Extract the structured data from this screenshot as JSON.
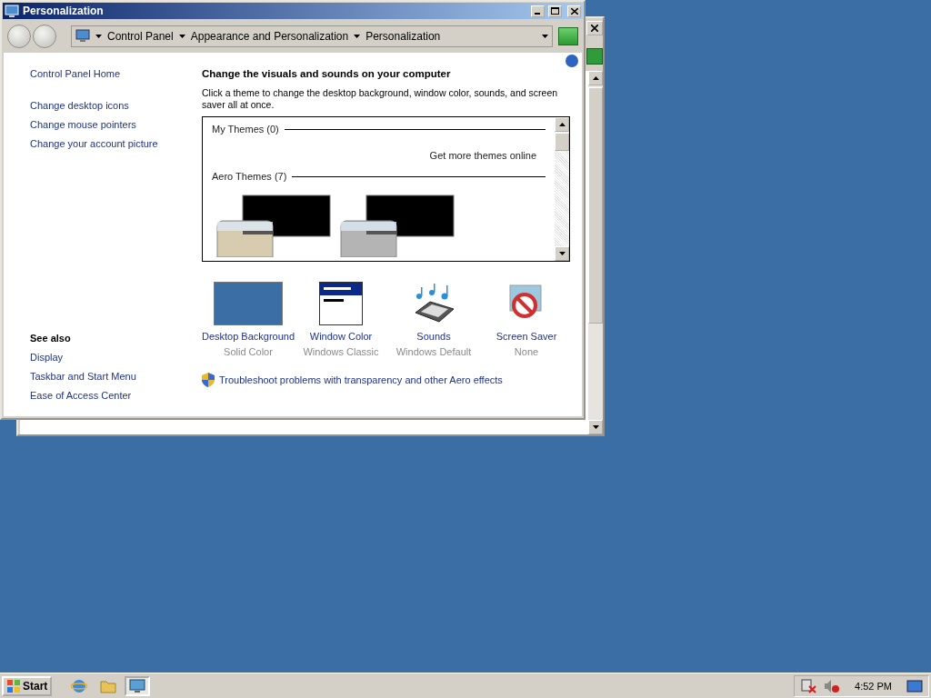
{
  "window": {
    "title": "Personalization",
    "breadcrumb": [
      "Control Panel",
      "Appearance and Personalization",
      "Personalization"
    ]
  },
  "sidebar": {
    "links": [
      "Control Panel Home",
      "Change desktop icons",
      "Change mouse pointers",
      "Change your account picture"
    ],
    "see_also_title": "See also",
    "see_also": [
      "Display",
      "Taskbar and Start Menu",
      "Ease of Access Center"
    ]
  },
  "main": {
    "heading": "Change the visuals and sounds on your computer",
    "description": "Click a theme to change the desktop background, window color, sounds, and screen saver all at once.",
    "theme_groups": [
      {
        "title": "My Themes (0)",
        "link": "Get more themes online"
      },
      {
        "title": "Aero Themes (7)",
        "themes": [
          {
            "kind": "beige"
          },
          {
            "kind": "silver"
          }
        ]
      }
    ],
    "settings": [
      {
        "kind": "background",
        "label": "Desktop Background",
        "value": "Solid Color"
      },
      {
        "kind": "window",
        "label": "Window Color",
        "value": "Windows Classic"
      },
      {
        "kind": "sounds",
        "label": "Sounds",
        "value": "Windows Default"
      },
      {
        "kind": "screensaver",
        "label": "Screen Saver",
        "value": "None"
      }
    ],
    "troubleshoot": "Troubleshoot problems with transparency and other Aero effects"
  },
  "taskbar": {
    "start": "Start",
    "apps": [
      {
        "kind": "browser",
        "selected": false
      },
      {
        "kind": "folder",
        "selected": false
      },
      {
        "kind": "control",
        "selected": true
      }
    ],
    "clock": "4:52 PM"
  }
}
